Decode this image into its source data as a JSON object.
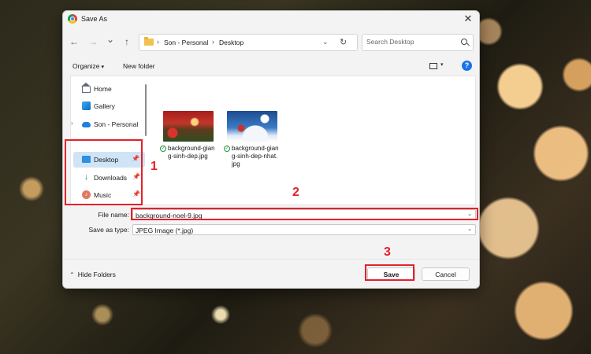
{
  "dialog": {
    "title": "Save As",
    "close_glyph": "✕"
  },
  "nav": {
    "back_glyph": "←",
    "forward_glyph": "→",
    "recent_glyph": "⌄",
    "up_glyph": "↑",
    "breadcrumb": [
      "Son - Personal",
      "Desktop"
    ],
    "separator": "›",
    "dropdown_glyph": "⌄",
    "refresh_glyph": "↻"
  },
  "search": {
    "placeholder": "Search Desktop"
  },
  "toolbar": {
    "organize_label": "Organize",
    "organize_arrow": "▾",
    "new_folder_label": "New folder",
    "view_arrow": "▾",
    "help_glyph": "?"
  },
  "sidebar": {
    "items": [
      {
        "label": "Home",
        "icon": "home-icon"
      },
      {
        "label": "Gallery",
        "icon": "gallery-icon"
      },
      {
        "label": "Son - Personal",
        "icon": "onedrive-cloud-icon",
        "expander": "›"
      },
      {
        "label": "Desktop",
        "icon": "desktop-icon",
        "selected": true,
        "pin": "📌"
      },
      {
        "label": "Downloads",
        "icon": "downloads-icon",
        "pin": "📌",
        "glyph": "↓"
      },
      {
        "label": "Music",
        "icon": "music-icon",
        "pin": "📌",
        "glyph": "♪"
      }
    ]
  },
  "files": [
    {
      "name": "background-giang-sinh-dep.jpg",
      "status": "✓"
    },
    {
      "name": "background-giang-sinh-dep-nhat.jpg",
      "status": "✓"
    }
  ],
  "form": {
    "file_name_label": "File name:",
    "file_name_value": "background-noel-9.jpg",
    "save_type_label": "Save as type:",
    "save_type_value": "JPEG Image (*.jpg)",
    "dropdown_glyph": "⌄"
  },
  "footer": {
    "hide_folders_label": "Hide Folders",
    "hide_folders_glyph": "⌃",
    "save_label": "Save",
    "cancel_label": "Cancel"
  },
  "annotations": {
    "step1": "1",
    "step2": "2",
    "step3": "3",
    "color": "#e2212b"
  }
}
